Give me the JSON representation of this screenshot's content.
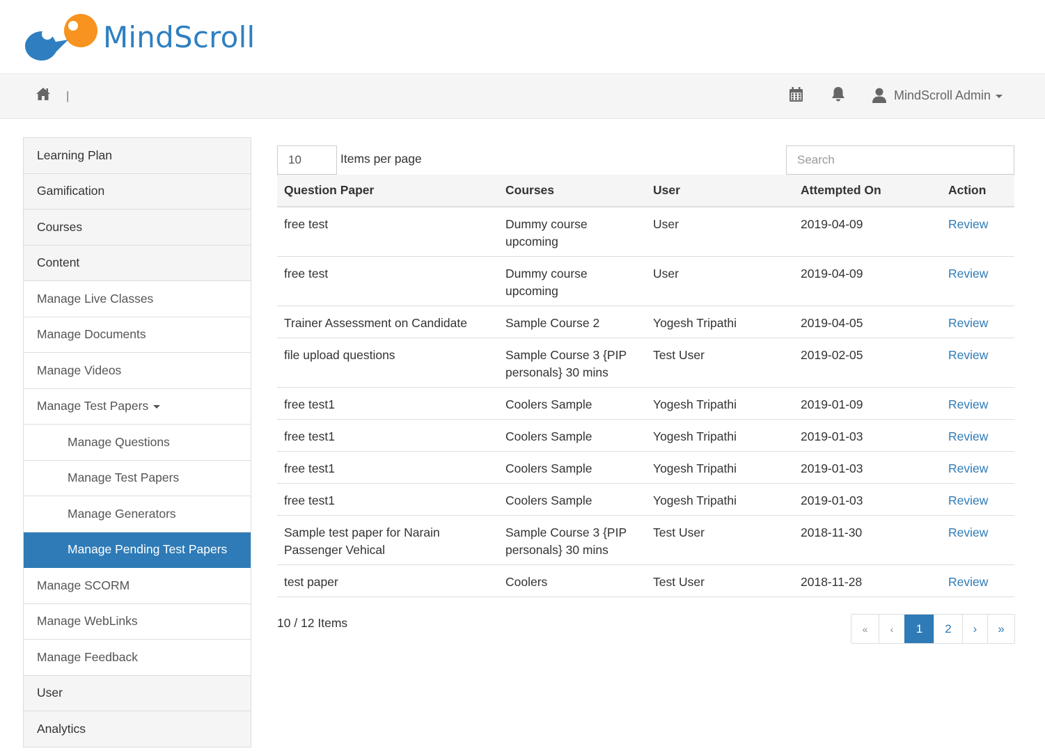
{
  "brand": {
    "name": "MindScroll"
  },
  "topbar": {
    "separator": "|",
    "user_name": "MindScroll Admin"
  },
  "sidebar": {
    "items": [
      {
        "label": "Learning Plan"
      },
      {
        "label": "Gamification"
      },
      {
        "label": "Courses"
      },
      {
        "label": "Content"
      },
      {
        "label": "Manage Live Classes"
      },
      {
        "label": "Manage Documents"
      },
      {
        "label": "Manage Videos"
      },
      {
        "label": "Manage Test Papers"
      },
      {
        "label": "Manage Questions"
      },
      {
        "label": "Manage Test Papers"
      },
      {
        "label": "Manage Generators"
      },
      {
        "label": "Manage Pending Test Papers"
      },
      {
        "label": "Manage SCORM"
      },
      {
        "label": "Manage WebLinks"
      },
      {
        "label": "Manage Feedback"
      },
      {
        "label": "User"
      },
      {
        "label": "Analytics"
      }
    ]
  },
  "controls": {
    "items_per_page_value": "10",
    "items_per_page_label": "Items per page",
    "search_placeholder": "Search"
  },
  "table": {
    "headers": [
      "Question Paper",
      "Courses",
      "User",
      "Attempted On",
      "Action"
    ],
    "rows": [
      [
        "free test",
        "Dummy course upcoming",
        "User",
        "2019-04-09",
        "Review"
      ],
      [
        "free test",
        "Dummy course upcoming",
        "User",
        "2019-04-09",
        "Review"
      ],
      [
        "Trainer Assessment on Candidate",
        "Sample Course 2",
        "Yogesh Tripathi",
        "2019-04-05",
        "Review"
      ],
      [
        "file upload questions",
        "Sample Course 3 {PIP personals} 30 mins",
        "Test User",
        "2019-02-05",
        "Review"
      ],
      [
        "free test1",
        "Coolers Sample",
        "Yogesh Tripathi",
        "2019-01-09",
        "Review"
      ],
      [
        "free test1",
        "Coolers Sample",
        "Yogesh Tripathi",
        "2019-01-03",
        "Review"
      ],
      [
        "free test1",
        "Coolers Sample",
        "Yogesh Tripathi",
        "2019-01-03",
        "Review"
      ],
      [
        "free test1",
        "Coolers Sample",
        "Yogesh Tripathi",
        "2019-01-03",
        "Review"
      ],
      [
        "Sample test paper for Narain Passenger Vehical",
        "Sample Course 3 {PIP personals} 30 mins",
        "Test User",
        "2018-11-30",
        "Review"
      ],
      [
        "test paper",
        "Coolers",
        "Test User",
        "2018-11-28",
        "Review"
      ]
    ]
  },
  "footer": {
    "count_text": "10 / 12 Items",
    "pagination": {
      "first": "«",
      "prev": "‹",
      "pages": [
        "1",
        "2"
      ],
      "active_page": "1",
      "next": "›",
      "last": "»"
    }
  },
  "colors": {
    "brand_blue": "#2f7fc0",
    "brand_orange": "#f7931e",
    "active_blue": "#2e7bb7"
  }
}
